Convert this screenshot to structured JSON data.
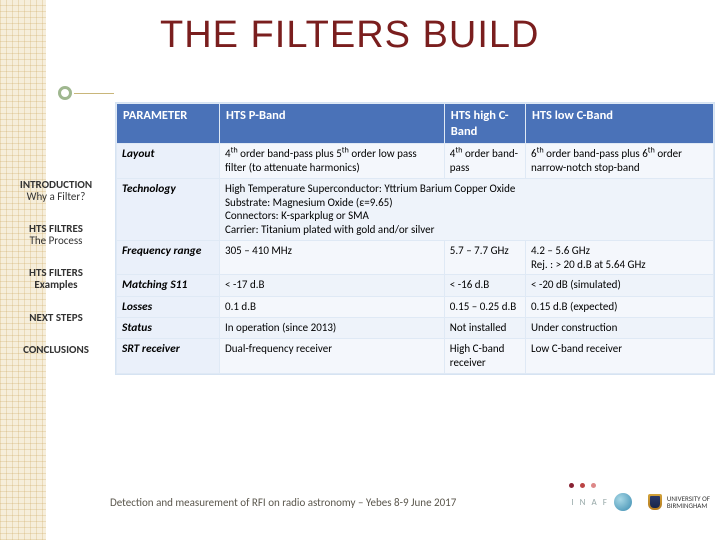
{
  "title": "THE FILTERS BUILD",
  "sidebar": {
    "items": [
      {
        "section": "INTRODUCTION",
        "sub": "Why a Filter?"
      },
      {
        "section": "HTS FILTRES",
        "sub": "The Process"
      },
      {
        "section": "HTS FILTERS",
        "sub": "Examples",
        "active": true
      },
      {
        "section": "NEXT STEPS",
        "sub": ""
      },
      {
        "section": "CONCLUSIONS",
        "sub": ""
      }
    ]
  },
  "table": {
    "columns": [
      "PARAMETER",
      "HTS P-Band",
      "HTS high C-Band",
      "HTS low C-Band"
    ],
    "rows": [
      {
        "header": "Layout",
        "cells": [
          "4th order band-pass plus 5th order low pass filter (to attenuate harmonics)",
          "4th order band-pass",
          "6th order band-pass plus 6th order narrow-notch stop-band"
        ],
        "sup": {
          "0": [
            [
              "4",
              "th"
            ],
            [
              "5",
              "th"
            ]
          ],
          "1": [
            [
              "4",
              "th"
            ]
          ],
          "2": [
            [
              "6",
              "th"
            ],
            [
              "6",
              "th"
            ]
          ]
        }
      },
      {
        "header": "Technology",
        "colspan": 3,
        "cells_joined": "High Temperature Superconductor: Yttrium Barium Copper Oxide\nSubstrate: Magnesium Oxide (ε=9.65)\nConnectors: K-sparkplug or SMA\nCarrier: Titanium plated with gold and/or silver"
      },
      {
        "header": "Frequency range",
        "cells": [
          "305 – 410 MHz",
          "5.7 – 7.7 GHz",
          "4.2 – 5.6 GHz\nRej. : > 20 d.B at 5.64 GHz"
        ]
      },
      {
        "header": "Matching S11",
        "cells": [
          "< -17 d.B",
          "< -16 d.B",
          "< -20 dB (simulated)"
        ]
      },
      {
        "header": "Losses",
        "cells": [
          "0.1 d.B",
          "0.15 – 0.25 d.B",
          "0.15 d.B (expected)"
        ]
      },
      {
        "header": "Status",
        "cells": [
          "In operation (since 2013)",
          "Not installed",
          "Under construction"
        ]
      },
      {
        "header": "SRT receiver",
        "cells": [
          "Dual-frequency receiver",
          "High C-band receiver",
          "Low C-band receiver"
        ]
      }
    ]
  },
  "footer": {
    "caption": "Detection and measurement of RFI on radio astronomy – Yebes 8-9 June 2017",
    "logos": {
      "inaf": "I N A F",
      "bham_line1": "UNIVERSITY OF",
      "bham_line2": "BIRMINGHAM"
    }
  },
  "chart_data": {
    "type": "table",
    "title": "THE FILTERS BUILD",
    "columns": [
      "PARAMETER",
      "HTS P-Band",
      "HTS high C-Band",
      "HTS low C-Band"
    ],
    "rows": [
      [
        "Layout",
        "4th order band-pass plus 5th order low pass filter (to attenuate harmonics)",
        "4th order band-pass",
        "6th order band-pass plus 6th order narrow-notch stop-band"
      ],
      [
        "Technology",
        "High Temperature Superconductor: Yttrium Barium Copper Oxide; Substrate: Magnesium Oxide (ε=9.65); Connectors: K-sparkplug or SMA; Carrier: Titanium plated with gold and/or silver",
        "(same, merged)",
        "(same, merged)"
      ],
      [
        "Frequency range",
        "305 – 410 MHz",
        "5.7 – 7.7 GHz",
        "4.2 – 5.6 GHz; Rej.: > 20 d.B at 5.64 GHz"
      ],
      [
        "Matching S11",
        "< -17 d.B",
        "< -16 d.B",
        "< -20 dB (simulated)"
      ],
      [
        "Losses",
        "0.1 d.B",
        "0.15 – 0.25 d.B",
        "0.15 d.B (expected)"
      ],
      [
        "Status",
        "In operation (since 2013)",
        "Not installed",
        "Under construction"
      ],
      [
        "SRT receiver",
        "Dual-frequency receiver",
        "High C-band receiver",
        "Low C-band receiver"
      ]
    ]
  }
}
